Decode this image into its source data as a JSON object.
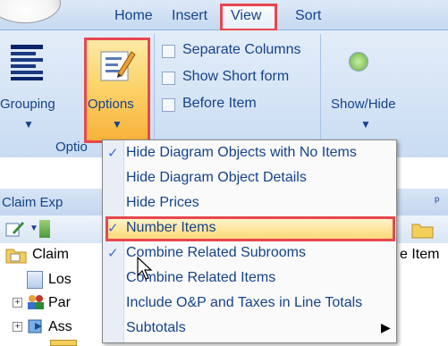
{
  "tabs": [
    {
      "label": "Home"
    },
    {
      "label": "Insert"
    },
    {
      "label": "View"
    },
    {
      "label": "Sort"
    }
  ],
  "ribbon": {
    "grouping_label": "Grouping",
    "options_label": "Options",
    "group_label_partial": "Optio",
    "separate_columns": "Separate Columns",
    "show_short_form": "Show Short form",
    "before_item": "Before Item",
    "show_hide": "Show/Hide"
  },
  "pane": {
    "title_partial": "Claim Exp",
    "pin_glyph": "ᵖ",
    "tree": [
      {
        "label": "Claim",
        "toggle": ""
      },
      {
        "label": "Los",
        "toggle": ""
      },
      {
        "label": "Par",
        "toggle": "+"
      },
      {
        "label": "Ass",
        "toggle": "+"
      }
    ],
    "right_partial": "e Item"
  },
  "menu": {
    "items": [
      {
        "label": "Hide Diagram Objects with No Items",
        "checked": true
      },
      {
        "label": "Hide Diagram Object Details",
        "checked": false
      },
      {
        "label": "Hide Prices",
        "checked": false
      },
      {
        "label": "Number Items",
        "checked": true
      },
      {
        "label": "Combine Related Subrooms",
        "checked": true,
        "highlighted": true
      },
      {
        "label": "Combine Related Items",
        "checked": false
      },
      {
        "label": "Include O&P and Taxes in Line Totals",
        "checked": false
      },
      {
        "label": "Subtotals",
        "checked": false,
        "submenu": true
      }
    ],
    "check_glyph": "✓"
  },
  "colors": {
    "highlight_border": "#e8474f",
    "ribbon_text": "#15428b",
    "option_button": "#fcd46b"
  }
}
